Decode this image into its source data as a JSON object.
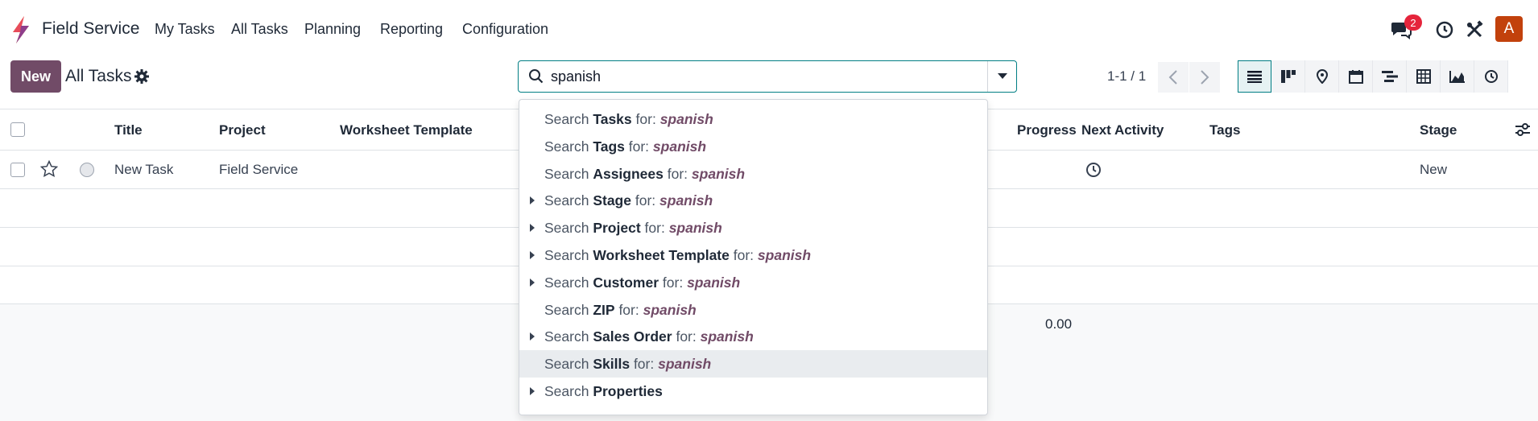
{
  "navbar": {
    "app_name": "Field Service",
    "menu": [
      "My Tasks",
      "All Tasks",
      "Planning",
      "Reporting",
      "Configuration"
    ],
    "messages_badge": "2",
    "avatar_letter": "A",
    "brand_color": "#714b67",
    "accent_color": "#017e84"
  },
  "control": {
    "new_label": "New",
    "breadcrumb": "All Tasks",
    "search_value": "spanish",
    "pager": "1-1 / 1"
  },
  "table": {
    "headers": {
      "title": "Title",
      "project": "Project",
      "worksheet": "Worksheet Template",
      "progress": "Progress",
      "next_activity": "Next Activity",
      "tags": "Tags",
      "stage": "Stage"
    },
    "rows": [
      {
        "title": "New Task",
        "project": "Field Service",
        "stage": "New"
      }
    ],
    "total_progress": "0.00"
  },
  "dropdown": {
    "prefix": "Search",
    "for": "for:",
    "query": "spanish",
    "items": [
      {
        "field": "Tasks",
        "caret": false
      },
      {
        "field": "Tags",
        "caret": false
      },
      {
        "field": "Assignees",
        "caret": false
      },
      {
        "field": "Stage",
        "caret": true
      },
      {
        "field": "Project",
        "caret": true
      },
      {
        "field": "Worksheet Template",
        "caret": true
      },
      {
        "field": "Customer",
        "caret": true
      },
      {
        "field": "ZIP",
        "caret": false
      },
      {
        "field": "Sales Order",
        "caret": true
      },
      {
        "field": "Skills",
        "caret": false,
        "highlighted": true
      },
      {
        "field": "Properties",
        "caret": true,
        "no_query": true
      }
    ]
  }
}
